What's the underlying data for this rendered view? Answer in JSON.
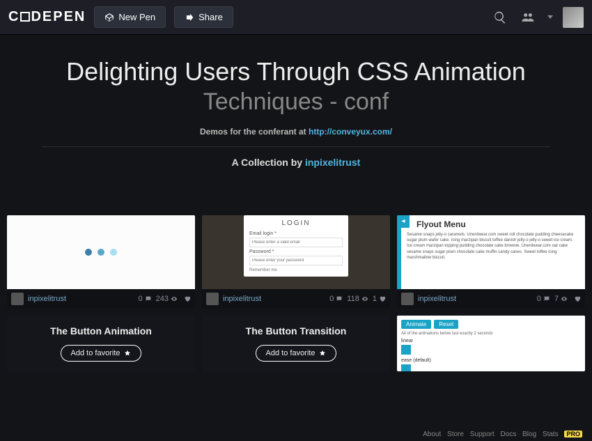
{
  "brand": "CODEPEN",
  "nav": {
    "new_pen": "New Pen",
    "share": "Share"
  },
  "header": {
    "title": "Delighting Users Through CSS Animation",
    "subtitle": "Techniques - conf",
    "desc_prefix": "Demos for the conferant at ",
    "desc_link": "http://conveyux.com/",
    "byline_prefix": "A Collection by ",
    "byline_author": "inpixelitrust"
  },
  "pens": [
    {
      "author": "inpixelitrust",
      "comments": 0,
      "views": 243,
      "loves": ""
    },
    {
      "author": "inpixelitrust",
      "comments": 0,
      "views": 118,
      "loves": 1,
      "login": {
        "title": "LOGIN",
        "email_label": "Email login *",
        "email_ph": "Please enter a valid email",
        "pw_label": "Password *",
        "pw_ph": "Please enter your password",
        "remember": "Remember me"
      }
    },
    {
      "author": "inpixelitrust",
      "comments": 0,
      "views": 7,
      "loves": "",
      "flyout": {
        "title": "Flyout Menu",
        "body": "Sesame snaps jelly-o caramels. Unerdwear.com sweet roll chocolate pudding cheesecake sugar plum wafer cake. Icing marzipan biscuit toffee danish jelly-o jelly-o sweet ice cream. Ice cream marzipan topping pudding chocolate cake brownie. Unerdwear.com oat cake sesame snaps sugar plum chocolate cake muffin candy canes. Sweet toffee icing marshmallow biscuit."
      }
    },
    {
      "title": "The Button Animation",
      "cta": "Add to favorite"
    },
    {
      "title": "The Button Transition",
      "cta": "Add to favorite"
    },
    {
      "anim": {
        "btn1": "Animate",
        "btn2": "Reset",
        "note": "All of the animations below last exactly 2 seconds",
        "l1": "linear",
        "l2": "ease (default)"
      }
    }
  ],
  "footer": [
    "About",
    "Store",
    "Support",
    "Docs",
    "Blog",
    "Stats"
  ],
  "pro": "PRO"
}
